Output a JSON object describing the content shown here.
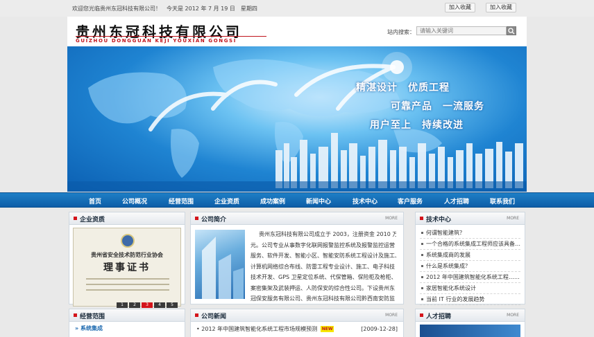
{
  "topbar": {
    "welcome": "欢迎您光临贵州东冠科技有限公司！　今天是 2012 年 7 月 19 日　星期四",
    "bookmark1": "加入收藏",
    "bookmark2": "加入收藏"
  },
  "header": {
    "company_cn": "贵州东冠科技有限公司",
    "company_en": "GUIZHOU DONGGUAN KEJI YOUXIAN GONGSI",
    "search_label": "站内搜索：",
    "search_placeholder": "请输入关键词"
  },
  "banner": {
    "slogans": [
      "精湛设计　优质工程",
      "可靠产品　一流服务",
      "用户至上　持续改进"
    ]
  },
  "nav": {
    "items": [
      "首页",
      "公司概况",
      "经营范围",
      "企业资质",
      "成功案例",
      "新闻中心",
      "技术中心",
      "客户服务",
      "人才招聘",
      "联系我们"
    ]
  },
  "qualification": {
    "title": "企业资质",
    "cert_org": "贵州省安全技术防范行业协会",
    "cert_title": "理事证书",
    "pages": [
      "1",
      "2",
      "3",
      "4",
      "5"
    ]
  },
  "intro": {
    "title": "公司简介",
    "more": "MORE",
    "lines": [
      "贵州东冠科技有限公司成立于 2003，注册资金 2010 万",
      "元。公司专业从事数字化联网报警监控系统及报警监控运营",
      "服务、软件开发、智能小区、智能安防系统工程设计及施工、",
      "计算机网络综合布线、防雷工程专业设计、施工、电子科技",
      "技术开发、GPS 卫星定位系统、代保管箱、保险柜及枪柜、",
      "案密集架及武装押运、人防保安的综合性公司。下设贵州东",
      "冠保安服务有限公司、贵州东冠科技有限公司黔西南安防监"
    ]
  },
  "tech": {
    "title": "技术中心",
    "more": "MORE",
    "items": [
      "何谓智能建筑？",
      "一个合格的系统集成工程师应该具备……",
      "系统集成商的发展",
      "什么是系统集成？",
      "2012 年中国建筑智能化系统工程……",
      "家居智能化系统设计",
      "当前 IT 行业的发展趋势"
    ]
  },
  "business": {
    "title": "经营范围",
    "sub": "系统集成"
  },
  "news": {
    "title": "公司新闻",
    "more": "MORE",
    "item": "2012 年中国建筑智能化系统工程市场规模预测",
    "badge": "NEW",
    "date": "[2009-12-28]"
  },
  "jobs": {
    "title": "人才招聘",
    "more": "MORE"
  }
}
